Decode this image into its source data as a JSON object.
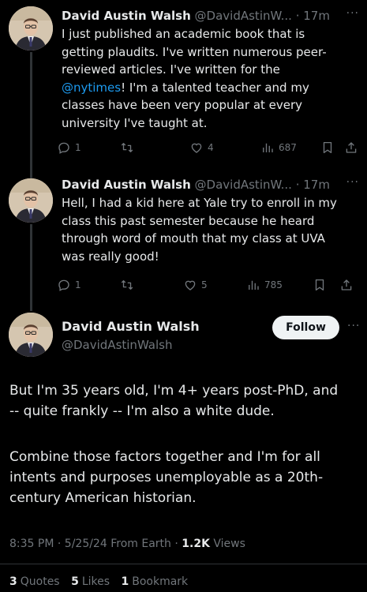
{
  "tweet1": {
    "author_name": "David Austin Walsh",
    "handle": "@DavidAstinW...",
    "separator": "·",
    "time": "17m",
    "more": "···",
    "text_lines": [
      "I just published an academic book that is",
      "getting plaudits. I've written numerous peer-",
      "reviewed articles. I've written for the",
      "classes have been very popular at every",
      "university I've taught at."
    ],
    "link_text": "@nytimes",
    "link_after": "! I'm a talented teacher and my",
    "actions": {
      "reply_count": "1",
      "retweet_count": "",
      "like_count": "4",
      "views_count": "687"
    }
  },
  "tweet2": {
    "author_name": "David Austin Walsh",
    "handle": "@DavidAstinW...",
    "separator": "·",
    "time": "17m",
    "more": "···",
    "text_lines": [
      "Hell, I had a kid here at Yale try to enroll in my",
      "class this past semester because he heard",
      "through word of mouth that my class at UVA",
      "was really good!"
    ],
    "actions": {
      "reply_count": "1",
      "retweet_count": "",
      "like_count": "5",
      "views_count": "785"
    }
  },
  "main_tweet": {
    "author_name": "David Austin Walsh",
    "handle": "@DavidAstinWalsh",
    "follow_label": "Follow",
    "more": "···",
    "paragraph1_lines": [
      "But I'm 35 years old, I'm 4+ years post-PhD, and",
      "-- quite frankly -- I'm also a white dude."
    ],
    "paragraph2_lines": [
      "Combine those factors together and I'm for all",
      "intents and purposes unemployable as a 20th-",
      "century American historian."
    ],
    "meta": {
      "time": "8:35 PM",
      "separator": "·",
      "date": "5/25/24",
      "source": "From Earth",
      "views_count": "1.2K",
      "views_label": "Views"
    },
    "stats": {
      "quotes_count": "3",
      "quotes_label": "Quotes",
      "likes_count": "5",
      "likes_label": "Likes",
      "bookmarks_count": "1",
      "bookmarks_label": "Bookmark"
    }
  },
  "colors": {
    "background": "#000000",
    "text": "#e7e9ea",
    "muted": "#71767b",
    "link": "#1d9bf0",
    "divider": "#2f3336",
    "follow_bg": "#eff3f4"
  },
  "icons": [
    "avatar",
    "reply-icon",
    "retweet-icon",
    "like-icon",
    "views-icon",
    "bookmark-icon",
    "share-icon"
  ]
}
